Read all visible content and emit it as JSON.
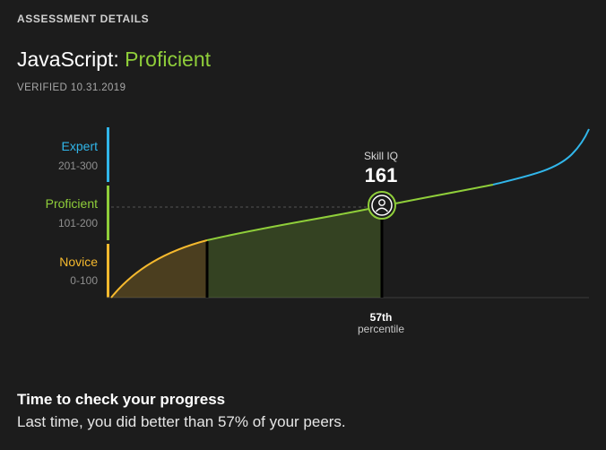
{
  "header": {
    "section_title": "ASSESSMENT DETAILS"
  },
  "assessment": {
    "skill": "JavaScript:",
    "level": "Proficient",
    "verified": "VERIFIED 10.31.2019"
  },
  "colors": {
    "novice": "#f5b92e",
    "proficient": "#8fce3a",
    "expert": "#31b6ea",
    "background": "#1c1c1c"
  },
  "bands": [
    {
      "name": "Expert",
      "range": "201-300",
      "color": "#31b6ea"
    },
    {
      "name": "Proficient",
      "range": "101-200",
      "color": "#8fce3a"
    },
    {
      "name": "Novice",
      "range": "0-100",
      "color": "#f5b92e"
    }
  ],
  "chart_data": {
    "type": "area",
    "y_range": [
      0,
      300
    ],
    "score_label": "Skill IQ",
    "score": 161,
    "percentile_value": "57th",
    "percentile_label": "percentile",
    "percentile": 57,
    "marker_icon": "user-icon"
  },
  "progress": {
    "heading": "Time to check your progress",
    "message": "Last time, you did better than 57% of your peers."
  }
}
